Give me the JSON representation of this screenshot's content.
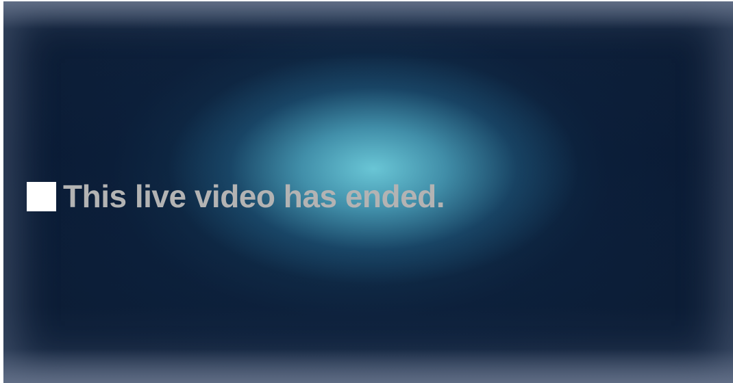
{
  "player": {
    "status_message": "This live video has ended.",
    "status_icon": "stop-icon"
  },
  "colors": {
    "background": "#0d1c33",
    "glow": "#6ecddc",
    "message_text": "#b3b3b3",
    "icon": "#ffffff"
  }
}
